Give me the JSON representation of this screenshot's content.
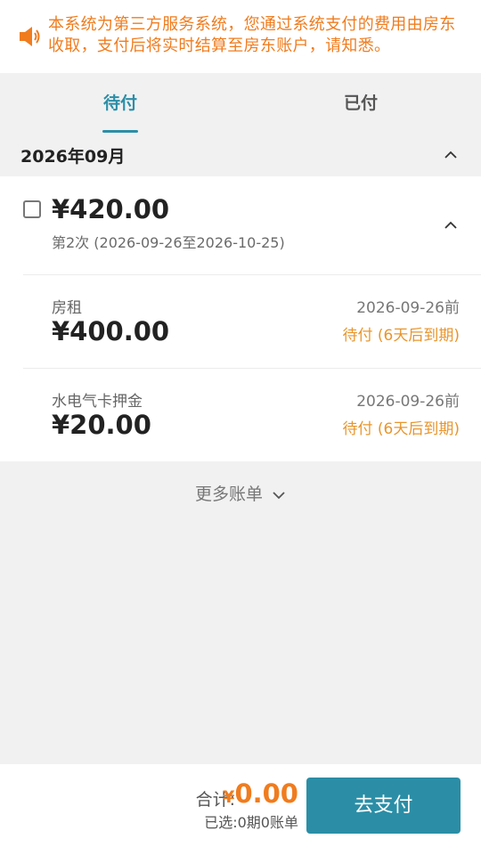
{
  "notice": {
    "text": "本系统为第三方服务系统，您通过系统支付的费用由房东收取，支付后将实时结算至房东账户，请知悉。",
    "icon": "speaker-icon"
  },
  "tabs": [
    {
      "label": "待付",
      "active": true
    },
    {
      "label": "已付",
      "active": false
    }
  ],
  "month": {
    "label": "2026年09月"
  },
  "bill": {
    "amount": "¥420.00",
    "period": "第2次 (2026-09-26至2026-10-25)",
    "checked": false,
    "items": [
      {
        "name": "房租",
        "amount": "¥400.00",
        "due_date": "2026-09-26前",
        "status": "待付 (6天后到期)"
      },
      {
        "name": "水电气卡押金",
        "amount": "¥20.00",
        "due_date": "2026-09-26前",
        "status": "待付 (6天后到期)"
      }
    ]
  },
  "more_bills": {
    "label": "更多账单"
  },
  "footer": {
    "total_label": "合计:",
    "currency": "¥",
    "total_value": "0.00",
    "selected_info": "已选:0期0账单",
    "pay_button": "去支付"
  },
  "colors": {
    "accent": "#2b8ea6",
    "warning": "#f07c1e",
    "status_pending": "#e8952c",
    "background": "#f1f1f2"
  }
}
